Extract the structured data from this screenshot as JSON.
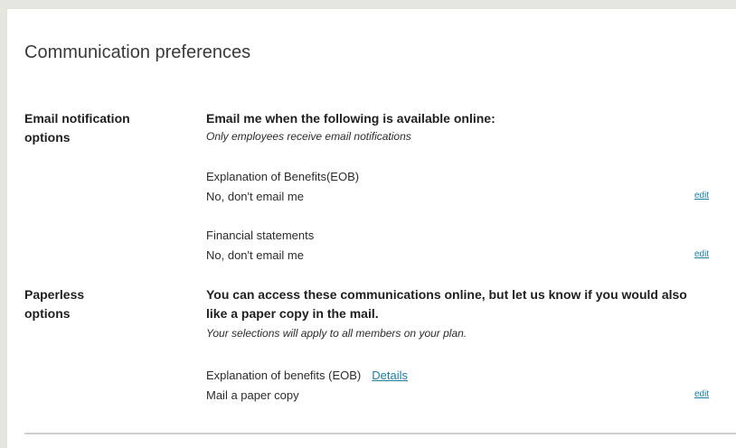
{
  "page_title": "Communication preferences",
  "email_section": {
    "label": "Email notification options",
    "heading": "Email me when the following is available online:",
    "note": "Only employees receive email notifications",
    "items": [
      {
        "name": "Explanation of Benefits(EOB)",
        "value": "No, don't email me",
        "action": "edit"
      },
      {
        "name": "Financial statements",
        "value": "No, don't email me",
        "action": "edit"
      }
    ]
  },
  "paperless_section": {
    "label": "Paperless options",
    "heading": "You can access these communications online, but let us know if you would also like a paper copy in the mail.",
    "note": "Your selections will apply to all members on your plan.",
    "items": [
      {
        "name": "Explanation of benefits (EOB)",
        "details_link": "Details",
        "value": "Mail a paper copy",
        "action": "edit"
      }
    ]
  },
  "colors": {
    "link": "#1a7fa0",
    "background": "#e6e6e0",
    "card": "#ffffff"
  }
}
